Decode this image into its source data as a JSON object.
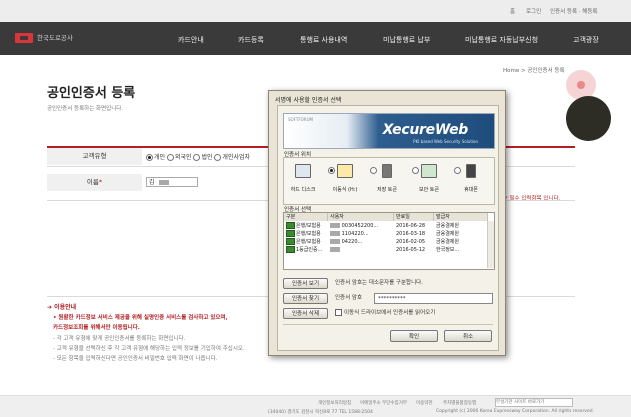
{
  "topbar": {
    "links": [
      "홈",
      "로그인",
      "인증서 등록 · 해등록"
    ]
  },
  "nav": {
    "logo_text": "한국도로공사",
    "items": [
      "카드안내",
      "카드등록",
      "통행료 사용내역",
      "미납통행료 납부",
      "미납통행료 자동납부신청",
      "고객광장"
    ]
  },
  "breadcrumb": "Home  >  공인인증서 등록",
  "page": {
    "title": "공인인증서 등록",
    "subtitle": "공인인증서 등록하는 화면입니다.",
    "form": {
      "type_label": "고객유형",
      "type_options": [
        "개인",
        "외국인",
        "법인",
        "개인사업자"
      ],
      "type_selected": "개인",
      "name_label": "이름",
      "name_value": "김",
      "required_note": "필수 입력항목 입니다."
    },
    "guide": {
      "title": "이용안내",
      "lines": [
        "• 원활한 카드정보 서비스 제공을 위해 실명인증 서비스를 검사하고 있으며,",
        "   카드정보조회를 위해서만 이용됩니다.",
        "- 각 고객 유형에 맞게 공인인증서를 등록하는 화면입니다.",
        "- 고객 유형을 선택하신 후 각 고객 유형에 해당하는 입력 정보를 기입하여 주십시오.",
        "- 모든 항목을 입력하신다면 공인인증서 비밀번호 입력 화면이 나옵니다."
      ]
    }
  },
  "footer": {
    "links": [
      "개인정보처리방침",
      "이메일주소 무단수집거부",
      "이용약관",
      "주차별물품잡동맵"
    ],
    "select": "부설기관 사이트 바로가기",
    "address": "(34040) 경기도 김천시 혁신8로 77  TEL 1588-2504",
    "copyright": "Copyright (c) 2006 Korea Expressway Corporation. All rights reserved."
  },
  "dialog": {
    "title": "서명에 사용할 인증서 선택",
    "banner_small": "SOFTFORUM",
    "brand": "XecureWeb",
    "brand_tag": "PKI based Web Security Solution",
    "location_title": "인증서 위치",
    "locations": [
      "하드 디스크",
      "이동식 (H:)",
      "저장 토큰",
      "보안 토큰",
      "휴대폰"
    ],
    "cert_title": "인증서 선택",
    "columns": [
      "구분",
      "사용자",
      "만료일",
      "발급자"
    ],
    "rows": [
      {
        "type": "은행/보험용",
        "user": "0030452200...",
        "expiry": "2016-06-28",
        "issuer": "금융결제원"
      },
      {
        "type": "은행/보험용",
        "user": "1104220...",
        "expiry": "2016-03-18",
        "issuer": "금융결제원"
      },
      {
        "type": "은행/보험용",
        "user": "04220...",
        "expiry": "2016-02-05",
        "issuer": "금융결제원"
      },
      {
        "type": "1등급인증...",
        "user": "",
        "expiry": "2016-05-12",
        "issuer": "한국정보..."
      }
    ],
    "btn_view": "인증서 보기",
    "btn_find": "인증서 찾기",
    "btn_delete": "인증서 삭제",
    "note_case": "인증서 암호는 대소문자를 구분합니다.",
    "pw_label": "인증서 암호",
    "pw_value": "**********",
    "note_drive": "이동식 드라이브에서 인증서를 읽어오기",
    "ok": "확인",
    "cancel": "취소"
  },
  "colors": {
    "nav_bg": "#3a3a3a",
    "accent_red": "#b31f24",
    "banner_blue": "#1f4c7c"
  }
}
